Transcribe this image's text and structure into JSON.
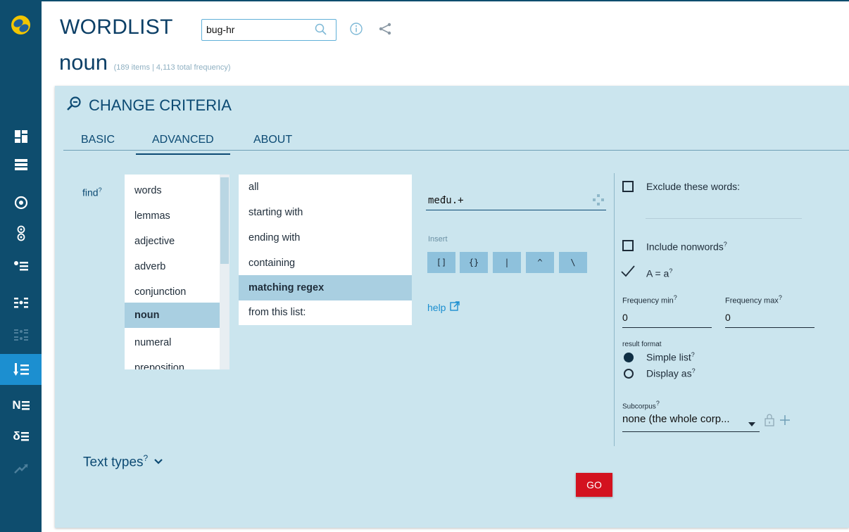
{
  "header": {
    "app_title": "WORDLIST",
    "corpus_value": "bug-hr"
  },
  "heading": {
    "pos": "noun",
    "summary": "(189 items | 4,113 total frequency)"
  },
  "panel": {
    "title": "CHANGE CRITERIA",
    "tabs": [
      "BASIC",
      "ADVANCED",
      "ABOUT"
    ],
    "active_tab": "ADVANCED"
  },
  "find": {
    "label": "find",
    "help_mark": "?",
    "attributes": [
      "words",
      "lemmas",
      "adjective",
      "adverb",
      "conjunction",
      "noun",
      "numeral",
      "preposition"
    ],
    "selected_attribute": "noun",
    "match_modes": [
      "all",
      "starting with",
      "ending with",
      "containing",
      "matching regex",
      "from this list:"
    ],
    "selected_mode": "matching regex"
  },
  "regex": {
    "value": "među.+",
    "insert_label": "Insert",
    "insert_buttons": [
      "[]",
      "{}",
      "|",
      "^",
      "\\"
    ],
    "help_label": "help"
  },
  "options": {
    "exclude_label": "Exclude these words:",
    "include_nonwords_label": "Include nonwords",
    "case_label": "A = a",
    "freq_min_label": "Frequency min",
    "freq_min_value": "0",
    "freq_max_label": "Frequency max",
    "freq_max_value": "0",
    "result_format_label": "result format",
    "simple_list_label": "Simple list",
    "display_as_label": "Display as",
    "result_format_selected": "Simple list",
    "subcorpus_label": "Subcorpus",
    "subcorpus_value": "none (the whole corp...",
    "help_mark": "?"
  },
  "text_types_label": "Text types",
  "go_label": "GO",
  "colors": {
    "sidebar": "#0e4d6e",
    "panel": "#cbe5ee",
    "accent": "#1c8fd0",
    "go": "#d3121f"
  }
}
